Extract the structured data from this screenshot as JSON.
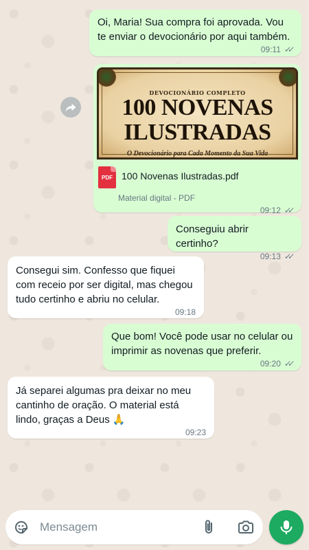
{
  "messages": {
    "m1": {
      "text": "Oi, Maria! Sua compra foi aprovada. Vou te enviar o devocionário por aqui também.",
      "time": "09:11",
      "ticks": "✓✓"
    },
    "doc": {
      "cover_subtitle": "DEVOCIONÁRIO COMPLETO",
      "cover_title_line1": "100 NOVENAS",
      "cover_title_line2": "ILUSTRADAS",
      "cover_tagline": "O Devocionário para Cada Momento da Sua Vida",
      "pdf_badge": "PDF",
      "file_name": "100 Novenas Ilustradas.pdf",
      "file_info": "Material digital - PDF",
      "time": "09:12",
      "ticks": "✓✓"
    },
    "m3": {
      "text": "Conseguiu abrir certinho?",
      "time": "09:13",
      "ticks": "✓✓"
    },
    "m4": {
      "text": "Consegui sim. Confesso que fiquei com receio por ser digital, mas chegou tudo certinho e abriu no celular.",
      "time": "09:18"
    },
    "m5": {
      "text": "Que bom! Você pode usar no celular ou imprimir as novenas que preferir.",
      "time": "09:20",
      "ticks": "✓✓"
    },
    "m6": {
      "text": "Já separei algumas pra deixar no meu cantinho de oração. O material está lindo, graças a Deus 🙏",
      "time": "09:23"
    }
  },
  "input": {
    "placeholder": "Mensagem"
  },
  "icons": {
    "forward": "forward-icon",
    "sticker": "sticker-icon",
    "attach": "paperclip-icon",
    "camera": "camera-icon",
    "mic": "mic-icon"
  },
  "colors": {
    "outgoing_bubble": "#d9fdd3",
    "incoming_bubble": "#ffffff",
    "wallpaper": "#efe7de",
    "mic_button": "#1daa61",
    "pdf_badge": "#e2303f"
  }
}
